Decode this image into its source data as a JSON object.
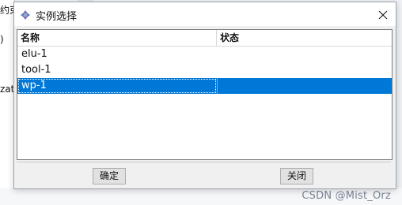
{
  "background": {
    "fragments": [
      "约束",
      ")",
      "zat"
    ],
    "watermark": "CSDN @Mist_Orz"
  },
  "dialog": {
    "title": "实例选择",
    "icon": "axis-arrows-icon",
    "columns": [
      "名称",
      "状态"
    ],
    "rows": [
      {
        "name": "elu-1",
        "status": ""
      },
      {
        "name": "tool-1",
        "status": ""
      },
      {
        "name": "wp-1",
        "status": "",
        "selected": true
      }
    ],
    "buttons": {
      "ok": "确定",
      "close": "关闭"
    }
  },
  "colors": {
    "selection": "#0078d7",
    "dialog_bg": "#f0f0f0"
  }
}
